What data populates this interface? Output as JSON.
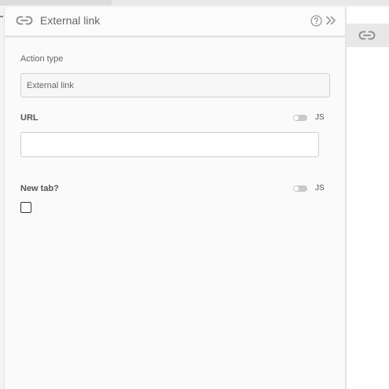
{
  "panel": {
    "title": "External link",
    "icons": {
      "header": "link-icon",
      "help": "help-circle-icon",
      "collapse": "double-chevron-right-icon"
    }
  },
  "fields": {
    "action_type": {
      "label": "Action type",
      "value": "External link"
    },
    "url": {
      "label": "URL",
      "value": "",
      "js_toggle_label": "JS"
    },
    "new_tab": {
      "label": "New tab?",
      "checked": false,
      "js_toggle_label": "JS"
    }
  },
  "right_sidebar": {
    "tab_icon": "link-icon"
  },
  "colors": {
    "panel_bg": "#fafafa",
    "border": "#cfcfcf",
    "text": "#666666"
  }
}
